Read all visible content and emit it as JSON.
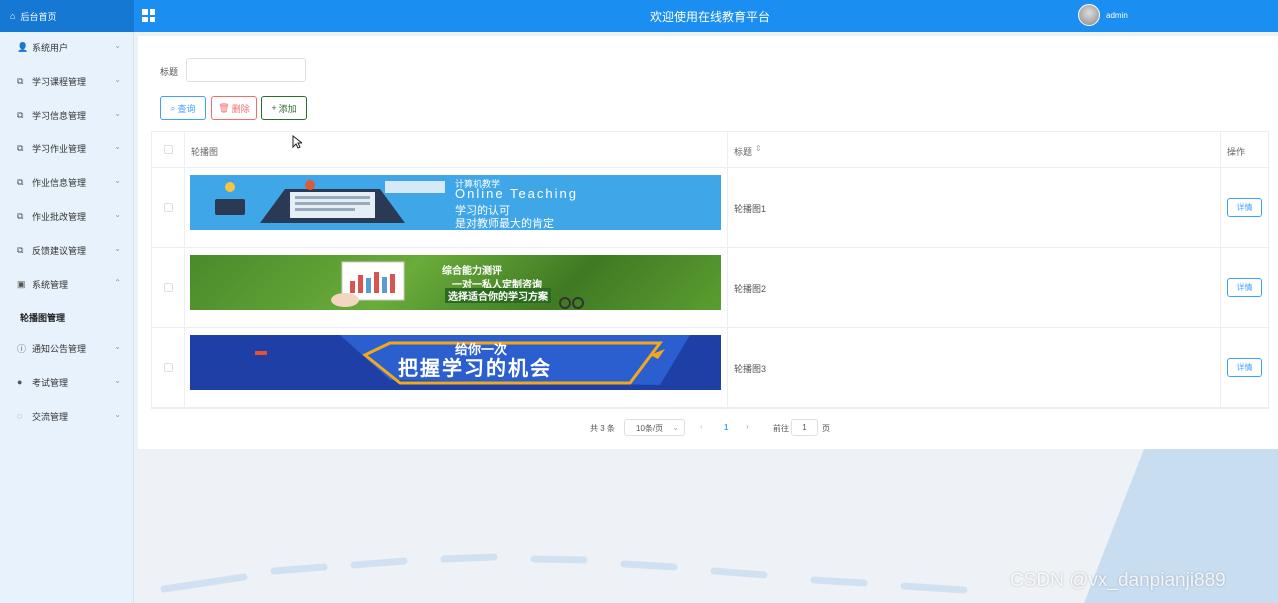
{
  "topbar": {
    "home_label": "后台首页",
    "title": "欢迎使用在线教育平台",
    "user": "admin",
    "brand_color": "#1b8ef2"
  },
  "sidebar": {
    "items": [
      {
        "label": "系统用户",
        "icon": "user-icon",
        "glyph": "👤",
        "chev": "⌄"
      },
      {
        "label": "学习课程管理",
        "icon": "external-box-icon",
        "glyph": "⧉",
        "chev": "⌄"
      },
      {
        "label": "学习信息管理",
        "icon": "external-box-icon",
        "glyph": "⧉",
        "chev": "⌄"
      },
      {
        "label": "学习作业管理",
        "icon": "external-box-icon",
        "glyph": "⧉",
        "chev": "⌄"
      },
      {
        "label": "作业信息管理",
        "icon": "external-box-icon",
        "glyph": "⧉",
        "chev": "⌄"
      },
      {
        "label": "作业批改管理",
        "icon": "external-box-icon",
        "glyph": "⧉",
        "chev": "⌄"
      },
      {
        "label": "反馈建议管理",
        "icon": "external-box-icon",
        "glyph": "⧉",
        "chev": "⌄"
      },
      {
        "label": "系统管理",
        "icon": "picture-icon",
        "glyph": "▣",
        "chev": "⌃"
      },
      {
        "label": "轮播图管理",
        "icon": "",
        "glyph": "",
        "chev": ""
      },
      {
        "label": "通知公告管理",
        "icon": "info-circle-icon",
        "glyph": "ⓘ",
        "chev": "⌄"
      },
      {
        "label": "考试管理",
        "icon": "location-pin-icon",
        "glyph": "●",
        "chev": "⌄"
      },
      {
        "label": "交流管理",
        "icon": "chat-bubble-icon",
        "glyph": "◌",
        "chev": "⌄"
      }
    ]
  },
  "search": {
    "label": "标题",
    "placeholder": "",
    "value": ""
  },
  "toolbar": {
    "search_label": "查询",
    "delete_label": "删除",
    "add_label": "添加"
  },
  "table": {
    "headers": {
      "image": "轮播图",
      "title": "标题",
      "ops": "操作"
    },
    "rows": [
      {
        "title": "轮播图1",
        "detail": "详情"
      },
      {
        "title": "轮播图2",
        "detail": "详情"
      },
      {
        "title": "轮播图3",
        "detail": "详情"
      }
    ]
  },
  "banners": {
    "b1_line1": "计算机教学",
    "b1_line2": "Online Teaching",
    "b1_line3": "学习的认可",
    "b1_line4": "是对教师最大的肯定",
    "b2_line1": "综合能力测评",
    "b2_line2": "一对一私人定制咨询",
    "b2_line3": "选择适合你的学习方案",
    "b3_line1": "给你一次",
    "b3_line2": "把握学习的机会"
  },
  "pagination": {
    "total": "共 3 条",
    "page_size": "10条/页",
    "current": "1",
    "goto": "前往",
    "goto_value": "1",
    "page_suffix": "页"
  },
  "watermark": "CSDN @vx_danpianji889"
}
